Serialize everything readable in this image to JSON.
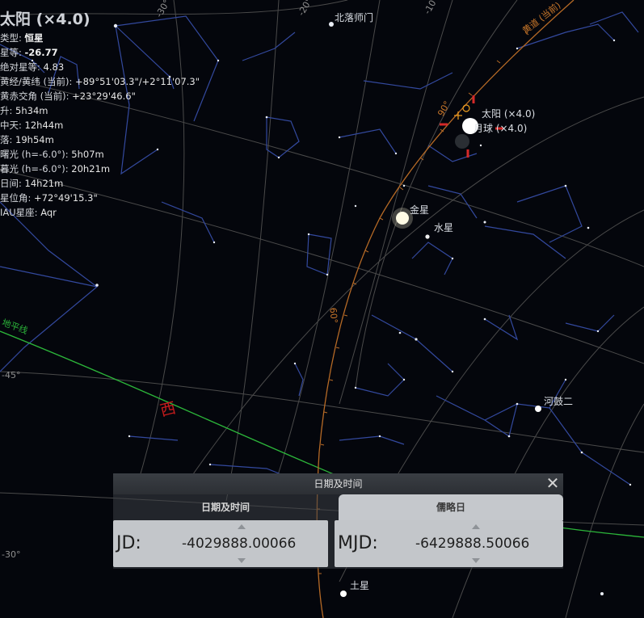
{
  "info": {
    "title": "太阳 (×4.0)",
    "rows": [
      {
        "k": "类型: ",
        "v": "恒星",
        "bold": true
      },
      {
        "k": "星等: ",
        "v": "-26.77",
        "bold": true
      },
      {
        "k": "绝对星等: ",
        "v": "4.83"
      },
      {
        "k": "黄经/黄纬 (当前): ",
        "v": "+89°51'03.3\"/+2°11'07.3\""
      },
      {
        "k": "黄赤交角 (当前): ",
        "v": "+23°29'46.6\""
      },
      {
        "k": "升: ",
        "v": "5h34m"
      },
      {
        "k": "中天: ",
        "v": "12h44m"
      },
      {
        "k": "落: ",
        "v": "19h54m"
      },
      {
        "k": "曙光 (h=-6.0°): ",
        "v": "5h07m"
      },
      {
        "k": "暮光 (h=-6.0°): ",
        "v": "20h21m"
      },
      {
        "k": "日间: ",
        "v": "14h21m"
      },
      {
        "k": "星位角: ",
        "v": "+72°49'15.3\""
      },
      {
        "k": "IAU星座: ",
        "v": "Aqr"
      }
    ]
  },
  "sky_labels": {
    "beiluo": "北落师门",
    "sun": "太阳 (×4.0)",
    "moon": "月球 (×4.0)",
    "venus": "金星",
    "mercury": "水星",
    "hegu": "河鼓二",
    "saturn": "土星",
    "west": "西",
    "horizon": "地平线",
    "ecliptic": "黄道 (当前)",
    "alt_m45": "-45°",
    "alt_m30": "-30°",
    "az_m30": "-30°",
    "az_m20": "-20°",
    "az_m10": "-10°",
    "ecl_90": "90°",
    "ecl_60": "60°"
  },
  "dialog": {
    "title": "日期及时间",
    "tab_datetime": "日期及时间",
    "tab_julian": "儒略日",
    "jd_label": "JD:",
    "jd_value": "-4029888.00066",
    "mjd_label": "MJD:",
    "mjd_value": "-6429888.50066"
  },
  "colors": {
    "sky": "#04060c",
    "constellation": "#3550a8",
    "grid": "#5a5a5a",
    "ecliptic": "#c9772a",
    "horizon": "#2cb63a",
    "cardinal": "#c81c1c"
  }
}
